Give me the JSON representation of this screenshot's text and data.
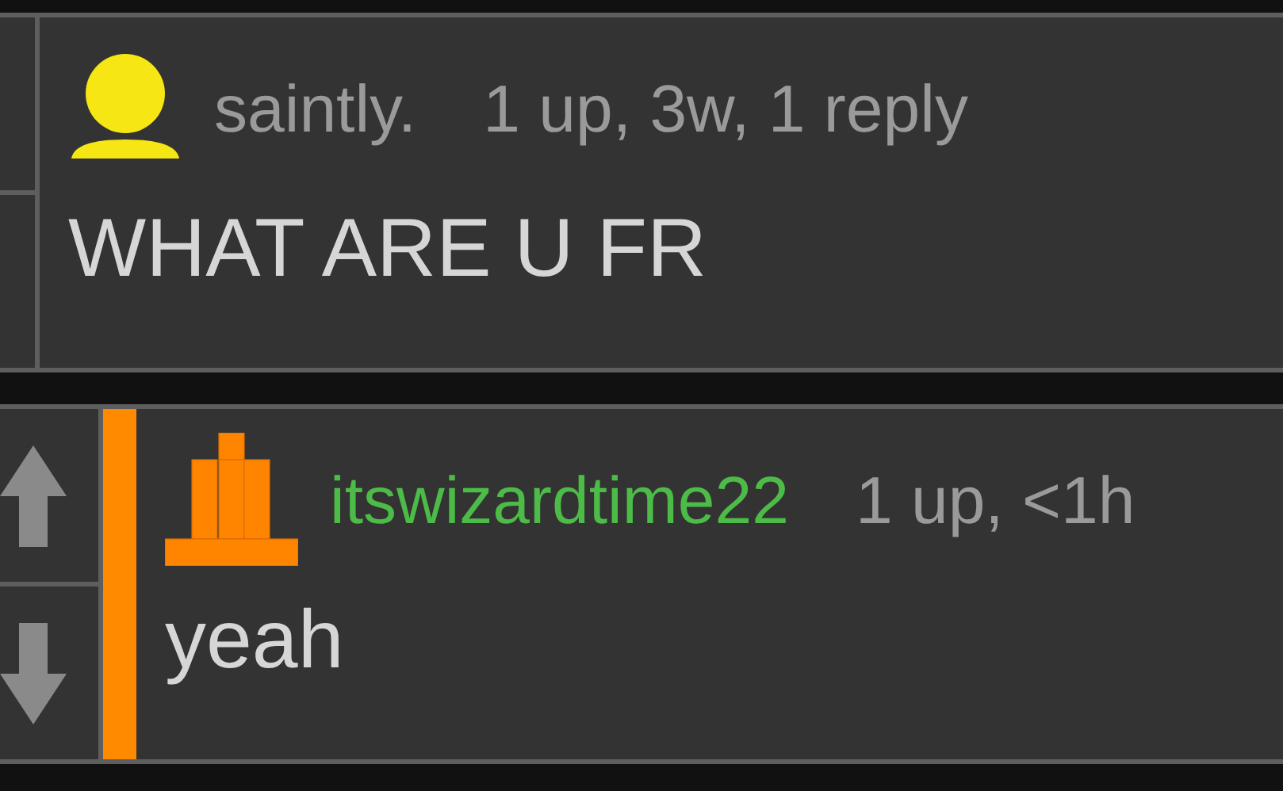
{
  "comments": [
    {
      "avatar": {
        "kind": "person",
        "color": "#f5e614"
      },
      "username": {
        "text": "saintly.",
        "color": "#9a9a9a"
      },
      "meta": "1 up, 3w, 1 reply",
      "body": "WHAT ARE U FR",
      "vote_arrows": false,
      "highlighted": false
    },
    {
      "avatar": {
        "kind": "hat",
        "color": "#ff8400"
      },
      "username": {
        "text": "itswizardtime22",
        "color": "#4cbb47"
      },
      "meta": "1 up, <1h",
      "body": "yeah",
      "vote_arrows": true,
      "highlighted": true
    }
  ]
}
